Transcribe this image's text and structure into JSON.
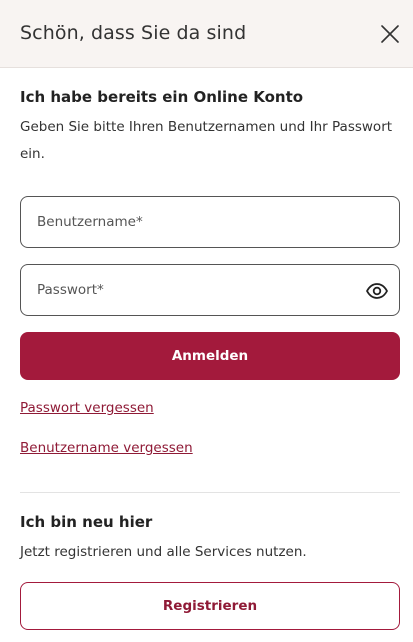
{
  "header": {
    "title": "Schön, dass Sie da sind",
    "close_icon": "close-icon"
  },
  "login": {
    "title": "Ich habe bereits ein Online Konto",
    "description": "Geben Sie bitte Ihren Benutzernamen und Ihr Passwort ein.",
    "username": {
      "placeholder": "Benutzername*",
      "value": ""
    },
    "password": {
      "placeholder": "Passwort*",
      "value": "",
      "toggle_icon": "eye-icon"
    },
    "submit_label": "Anmelden",
    "forgot_password_label": "Passwort vergessen",
    "forgot_username_label": "Benutzername vergessen"
  },
  "register": {
    "title": "Ich bin neu hier",
    "description": "Jetzt registrieren und alle Services nutzen.",
    "button_label": "Registrieren"
  },
  "colors": {
    "accent": "#a31a3c",
    "link": "#8f1a36",
    "header_bg": "#f8f4f2"
  }
}
